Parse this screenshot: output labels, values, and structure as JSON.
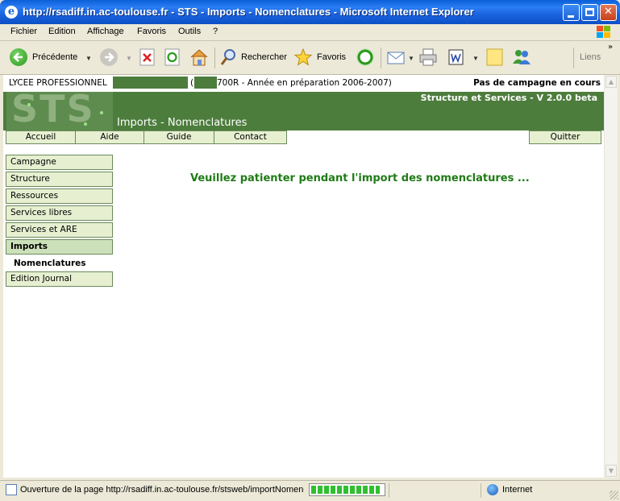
{
  "window": {
    "title": "http://rsadiff.in.ac-toulouse.fr - STS - Imports - Nomenclatures - Microsoft Internet Explorer"
  },
  "menu": [
    "Fichier",
    "Edition",
    "Affichage",
    "Favoris",
    "Outils",
    "?"
  ],
  "toolbar": {
    "back": "Précédente",
    "search": "Rechercher",
    "favorites": "Favoris",
    "links": "Liens"
  },
  "page": {
    "school": "LYCEE PROFESSIONNEL",
    "paren_open": "(",
    "year_info": "700R - Année en préparation 2006-2007)",
    "campaign": "Pas de campagne en cours",
    "version": "Structure et Services - V 2.0.0 beta",
    "logo": "STS",
    "page_title": "Imports - Nomenclatures",
    "nav": {
      "home": "Accueil",
      "help": "Aide",
      "guide": "Guide",
      "contact": "Contact",
      "quit": "Quitter"
    },
    "sidebar": [
      "Campagne",
      "Structure",
      "Ressources",
      "Services libres",
      "Services et ARE",
      "Imports",
      "Edition Journal"
    ],
    "sidebar_sub": "Nomenclatures",
    "message": "Veuillez patienter pendant l'import des nomenclatures ..."
  },
  "status": {
    "text": "Ouverture de la page http://rsadiff.in.ac-toulouse.fr/stsweb/importNomenclatures",
    "zone": "Internet",
    "progress": 0.95
  },
  "colors": {
    "banner": "#4d7d3d",
    "nav_bg": "#e6f0d1",
    "message": "#1f7b16"
  }
}
